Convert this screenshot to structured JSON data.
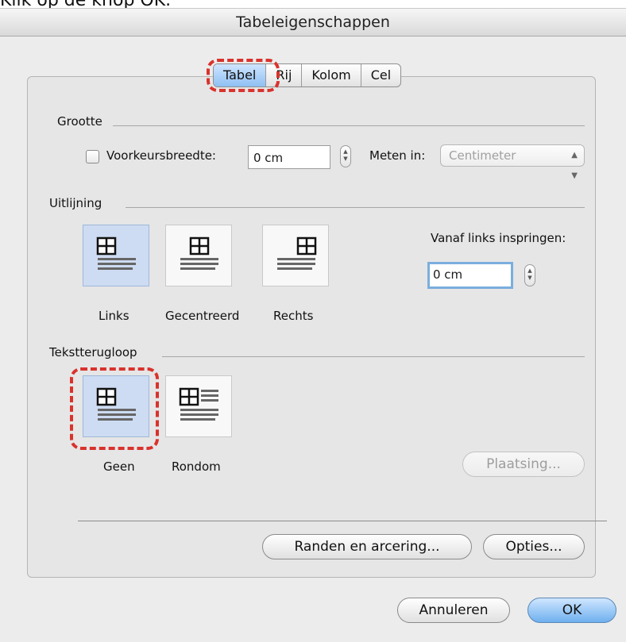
{
  "caption": "Klik op de knop OK.",
  "window": {
    "title": "Tabeleigenschappen"
  },
  "tabs": [
    {
      "label": "Tabel",
      "active": true
    },
    {
      "label": "Rij",
      "active": false
    },
    {
      "label": "Kolom",
      "active": false
    },
    {
      "label": "Cel",
      "active": false
    }
  ],
  "grootte": {
    "section_title": "Grootte",
    "voorkeursbreedte_label": "Voorkeursbreedte:",
    "voorkeursbreedte_checked": false,
    "voorkeursbreedte_value": "0 cm",
    "meten_in_label": "Meten in:",
    "meten_in_value": "Centimeter"
  },
  "uitlijning": {
    "section_title": "Uitlijning",
    "options": [
      {
        "label": "Links",
        "selected": true
      },
      {
        "label": "Gecentreerd",
        "selected": false
      },
      {
        "label": "Rechts",
        "selected": false
      }
    ],
    "inspringen_label": "Vanaf links inspringen:",
    "inspringen_value": "0 cm"
  },
  "tekstterugloop": {
    "section_title": "Tekstterugloop",
    "options": [
      {
        "label": "Geen",
        "selected": true
      },
      {
        "label": "Rondom",
        "selected": false
      }
    ],
    "plaatsing_label": "Plaatsing..."
  },
  "buttons": {
    "randen_label": "Randen en arcering...",
    "opties_label": "Opties...",
    "annuleren_label": "Annuleren",
    "ok_label": "OK"
  },
  "colors": {
    "highlight_dash": "#d9322d",
    "selected_option": "#cddcf2",
    "primary_button": "#6fb0ef"
  }
}
